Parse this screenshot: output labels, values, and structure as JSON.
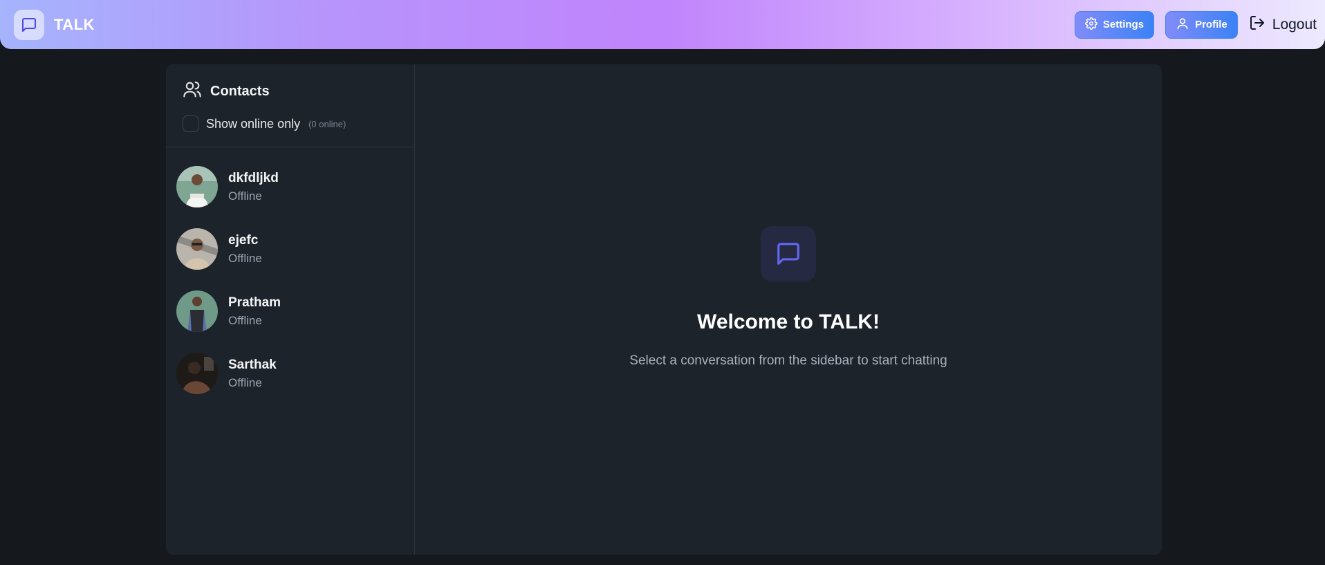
{
  "app": {
    "name": "TALK"
  },
  "nav": {
    "settings_label": "Settings",
    "profile_label": "Profile",
    "logout_label": "Logout"
  },
  "sidebar": {
    "title": "Contacts",
    "filter_label": "Show online only",
    "online_count": "(0 online)",
    "contacts": [
      {
        "name": "dkfdljkd",
        "status": "Offline"
      },
      {
        "name": "ejefc",
        "status": "Offline"
      },
      {
        "name": "Pratham",
        "status": "Offline"
      },
      {
        "name": "Sarthak",
        "status": "Offline"
      }
    ]
  },
  "welcome": {
    "title": "Welcome to TALK!",
    "subtitle": "Select a conversation from the sidebar to start chatting"
  },
  "colors": {
    "accent": "#3b82f6",
    "background": "#15191e",
    "panel": "#1d232a",
    "welcome_icon": "#6366f1"
  },
  "icons": {
    "brand": "message-square-icon",
    "settings": "gear-icon",
    "profile": "user-icon",
    "logout": "logout-icon",
    "contacts": "users-icon",
    "welcome": "message-square-icon"
  }
}
